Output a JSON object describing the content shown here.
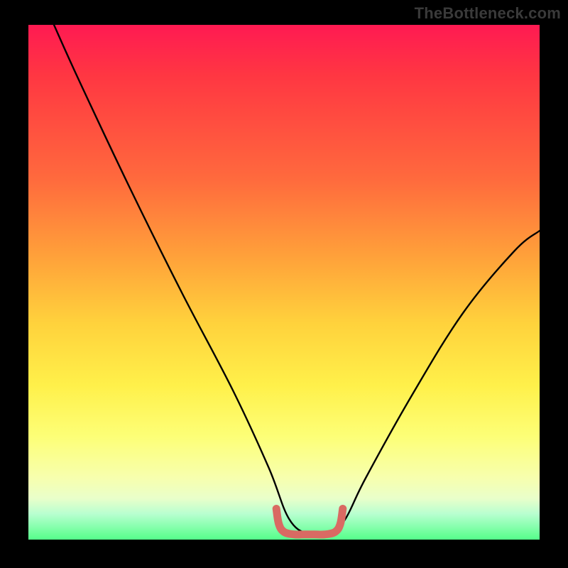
{
  "watermark": "TheBottleneck.com",
  "chart_data": {
    "type": "line",
    "title": "",
    "xlabel": "",
    "ylabel": "",
    "xlim": [
      0,
      100
    ],
    "ylim": [
      0,
      100
    ],
    "grid": false,
    "legend": false,
    "series": [
      {
        "name": "bottleneck-curve",
        "color": "#000000",
        "x": [
          5,
          10,
          20,
          30,
          40,
          47,
          51,
          55,
          59,
          62,
          66,
          75,
          85,
          95,
          100
        ],
        "values": [
          100,
          89,
          68,
          48,
          29,
          14,
          4,
          1,
          1,
          4,
          12,
          28,
          44,
          56,
          60
        ]
      },
      {
        "name": "optimal-band",
        "color": "#d96a63",
        "x": [
          48.5,
          49,
          50,
          52,
          54,
          56,
          58,
          60,
          61,
          61.5
        ],
        "values": [
          6,
          3,
          1.5,
          1,
          1,
          1,
          1,
          1.5,
          3,
          6
        ]
      }
    ],
    "background_gradient_stops": [
      {
        "pos": 0,
        "color": "#ff1a52"
      },
      {
        "pos": 10,
        "color": "#ff3742"
      },
      {
        "pos": 30,
        "color": "#ff6a3d"
      },
      {
        "pos": 45,
        "color": "#ffa13a"
      },
      {
        "pos": 58,
        "color": "#ffd23c"
      },
      {
        "pos": 70,
        "color": "#fff04a"
      },
      {
        "pos": 80,
        "color": "#fdff77"
      },
      {
        "pos": 88,
        "color": "#f7ffae"
      },
      {
        "pos": 92,
        "color": "#e9ffca"
      },
      {
        "pos": 95,
        "color": "#b8ffd0"
      },
      {
        "pos": 100,
        "color": "#55ff8a"
      }
    ]
  }
}
